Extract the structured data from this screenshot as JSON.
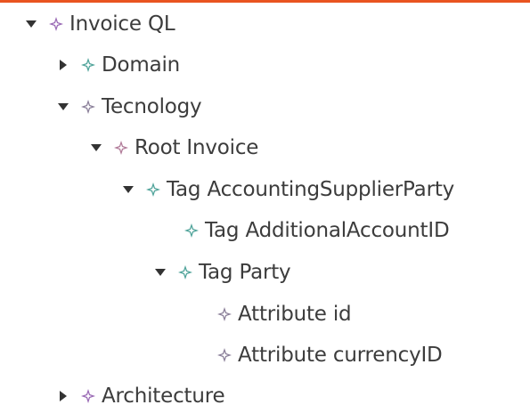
{
  "colors": {
    "accent_bar": "#e95420",
    "twisty": "#333333",
    "label_text": "#3c3c3c",
    "icon_purple": "#9a6ab5",
    "icon_teal": "#4fa39a",
    "icon_pink": "#b07a98",
    "icon_gray": "#8a7f99"
  },
  "tree": {
    "nodes": [
      {
        "label": "Invoice QL",
        "state": "expanded",
        "icon": "diamond-star-icon",
        "icon_color": "#9a6ab5"
      },
      {
        "label": "Domain",
        "state": "collapsed",
        "icon": "diamond-star-icon",
        "icon_color": "#4fa39a"
      },
      {
        "label": "Tecnology",
        "state": "expanded",
        "icon": "diamond-star-icon",
        "icon_color": "#8a7f99"
      },
      {
        "label": "Root Invoice",
        "state": "expanded",
        "icon": "diamond-star-icon",
        "icon_color": "#b07a98"
      },
      {
        "label": "Tag AccountingSupplierParty",
        "state": "expanded",
        "icon": "diamond-star-icon",
        "icon_color": "#4fa39a"
      },
      {
        "label": "Tag AdditionalAccountID",
        "state": "leaf",
        "icon": "diamond-star-icon",
        "icon_color": "#4fa39a"
      },
      {
        "label": "Tag Party",
        "state": "expanded",
        "icon": "diamond-star-icon",
        "icon_color": "#4fa39a"
      },
      {
        "label": "Attribute id",
        "state": "leaf",
        "icon": "diamond-star-icon",
        "icon_color": "#8a7f99"
      },
      {
        "label": "Attribute currencyID",
        "state": "leaf",
        "icon": "diamond-star-icon",
        "icon_color": "#8a7f99"
      },
      {
        "label": "Architecture",
        "state": "collapsed",
        "icon": "diamond-star-icon",
        "icon_color": "#9a6ab5"
      }
    ]
  }
}
